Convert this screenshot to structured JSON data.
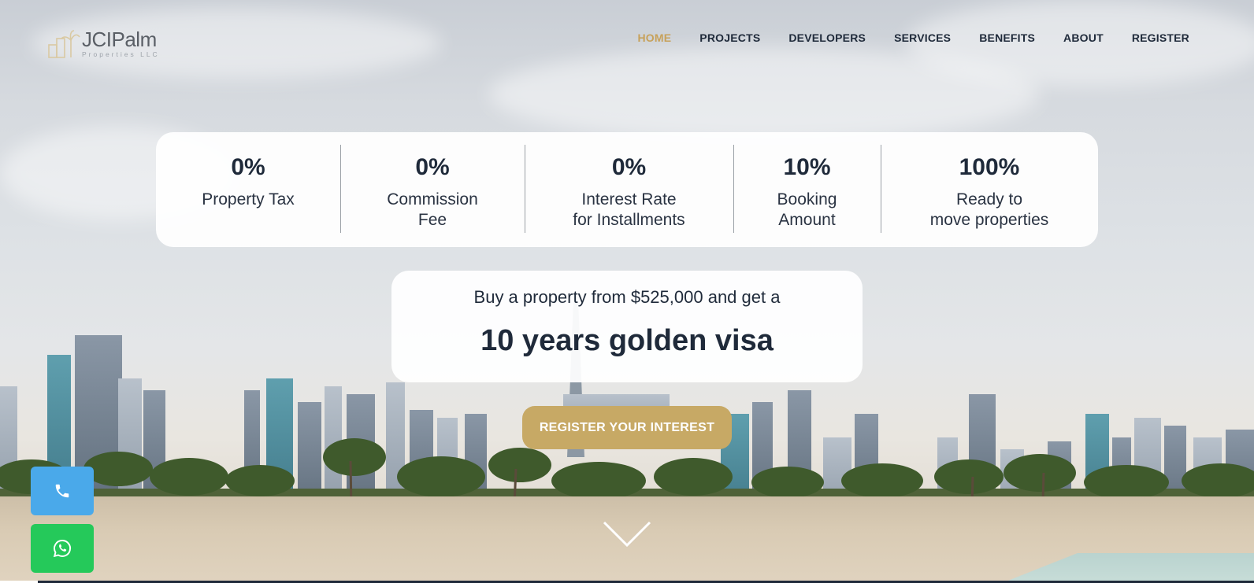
{
  "brand": {
    "name": "JCIPalm",
    "tagline": "Properties LLC",
    "accent_color": "#c7a15a",
    "text_color": "#1f2a3a"
  },
  "nav": {
    "items": [
      {
        "label": "HOME",
        "active": true
      },
      {
        "label": "PROJECTS",
        "active": false
      },
      {
        "label": "DEVELOPERS",
        "active": false
      },
      {
        "label": "SERVICES",
        "active": false
      },
      {
        "label": "BENEFITS",
        "active": false
      },
      {
        "label": "ABOUT",
        "active": false
      },
      {
        "label": "REGISTER",
        "active": false
      }
    ]
  },
  "stats": [
    {
      "value": "0%",
      "label": "Property Tax"
    },
    {
      "value": "0%",
      "label": "Commission\nFee"
    },
    {
      "value": "0%",
      "label": "Interest Rate\nfor Installments"
    },
    {
      "value": "10%",
      "label": "Booking\nAmount"
    },
    {
      "value": "100%",
      "label": "Ready to\nmove properties"
    }
  ],
  "visa": {
    "line1": "Buy a property from $525,000 and get a",
    "line2": "10 years golden visa"
  },
  "cta": {
    "label": "REGISTER YOUR INTEREST",
    "color": "#c7a965"
  },
  "contact": {
    "call_icon": "phone-icon",
    "call_color": "#4aa9ea",
    "whatsapp_icon": "whatsapp-icon",
    "whatsapp_color": "#25c95a"
  },
  "scroll_icon": "chevron-down-icon"
}
